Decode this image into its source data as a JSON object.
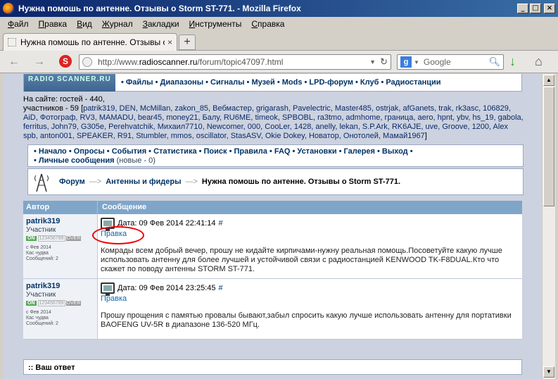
{
  "window": {
    "title": "Нужна помошь по антенне. Отзывы о Storm ST-771. - Mozilla Firefox",
    "controls": [
      "_",
      "□",
      "×"
    ]
  },
  "menu": [
    "Файл",
    "Правка",
    "Вид",
    "Журнал",
    "Закладки",
    "Инструменты",
    "Справка"
  ],
  "tab": {
    "label": "Нужна помошь по антенне. Отзывы о Stor...",
    "close": "×",
    "new": "+"
  },
  "nav": {
    "url_prefix": "http://www.",
    "url_domain": "radioscanner.ru",
    "url_path": "/forum/topic47097.html",
    "search_placeholder": "Google",
    "search_engine_letter": "g"
  },
  "site": {
    "logo": "RADIO SCANNER.RU",
    "topnav": "• Файлы • Диапазоны • Сигналы • Музей • Mods • LPD-форум • Клуб • Радиостанции",
    "online_line1": "На сайте: гостей - 440,",
    "online_line2_prefix": "участников - 59 [",
    "online_names": "patrik319, DEN, McMillan, zakon_85, Вебмастер, grigarash, Pavelectric, Master485, ostrjak, afGanets, trak, rk3asc, 106829, AiD, Фотограф, RV3, MAMADU, bear45, money21, Балу, RU6ME, timeok, SPBOBL, ra3tmo, admhome, граница, aero, hpnt, ybv, hs_19, gabola, ferritus, John79, G305e, Perehvatchik, Михаил7710, Newcomer, 000, CooLer, 1428, anelly, lekan, S.P.Ark, RK6AJE, uve, Groove, 1200, Alex spb, anton001, SPEAKER, R91, Stumbler, mmos, oscillator, StasASV, Okie Dokey, Новатор, Онотолей, Мамай1967",
    "online_suffix": "]",
    "navlinks": "• Начало • Опросы • События • Статистика • Поиск • Правила • FAQ • Установки • Галерея • Выход •",
    "personal": "Личные сообщения",
    "personal_new": "(новые - 0)"
  },
  "breadcrumb": {
    "forum": "Форум",
    "section": "Антенны и фидеры",
    "current": "Нужна помошь по антенне. Отзывы о Storm ST-771.",
    "arrow": "—>"
  },
  "table": {
    "col_author": "Автор",
    "col_message": "Сообщение"
  },
  "posts": [
    {
      "author": "patrik319",
      "role": "Участник",
      "on": "ON",
      "bar": "123456789",
      "over": "OVER",
      "meta1": "с Фев 2014",
      "meta2": "Кас чудва",
      "meta3": "Сообщений: 2",
      "date": "Дата: 09 Фев 2014 22:41:14",
      "hash": "#",
      "edit": "Правка",
      "text": "Комрады всем добрый вечер, прошу не кидайте кирпичами-нужну реальная помощь.Посоветуйте какую лучше использовать антенну для более лучшей и устойчивой связи с радиостанцией KENWOOD TK-F8DUAL.Кто что скажет по поводу антенны STORM ST-771."
    },
    {
      "author": "patrik319",
      "role": "Участник",
      "on": "ON",
      "bar": "123456789",
      "over": "OVER",
      "meta1": "с Фев 2014",
      "meta2": "Кас чудва",
      "meta3": "Сообщений: 2",
      "date": "Дата: 09 Фев 2014 23:25:45",
      "hash": "#",
      "edit": "Правка",
      "text": "Прошу прощения с памятью провалы бывают,забыл спросить какую лучше использовать антенну для портативки BAOFENG UV-5R в диапазоне 136-520 МГц."
    }
  ],
  "reply": ":: Ваш ответ"
}
